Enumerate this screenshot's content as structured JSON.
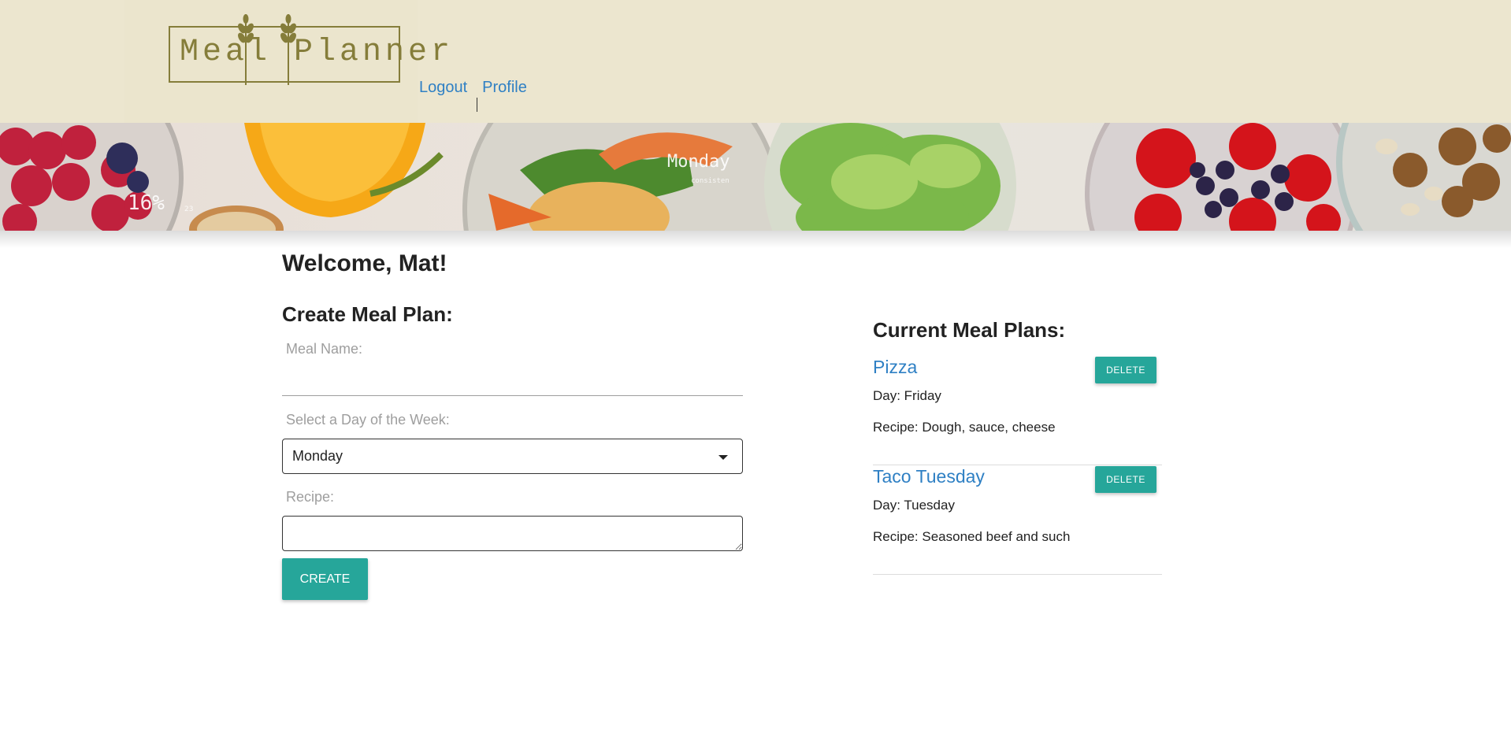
{
  "header": {
    "logo_text": "Meal Planner",
    "nav": {
      "logout": "Logout",
      "profile": "Profile"
    }
  },
  "banner": {
    "overlay_percent": "16%",
    "overlay_day": "Monday",
    "overlay_small": "consisten",
    "overlay_num": "23"
  },
  "main": {
    "welcome": "Welcome, Mat!",
    "create_title": "Create Meal Plan:",
    "meal_name_label": "Meal Name:",
    "meal_name_value": "",
    "day_label": "Select a Day of the Week:",
    "day_selected": "Monday",
    "recipe_label": "Recipe:",
    "recipe_value": "",
    "create_button": "CREATE"
  },
  "plans": {
    "title": "Current Meal Plans:",
    "delete_label": "DELETE",
    "items": [
      {
        "name": "Pizza",
        "day": "Day: Friday",
        "recipe": "Recipe: Dough, sauce, cheese"
      },
      {
        "name": "Taco Tuesday",
        "day": "Day: Tuesday",
        "recipe": "Recipe: Seasoned beef and such"
      }
    ]
  },
  "colors": {
    "header_bg": "#ece6cf",
    "logo": "#857d3a",
    "link": "#2f80c4",
    "accent_button": "#26a69a"
  }
}
